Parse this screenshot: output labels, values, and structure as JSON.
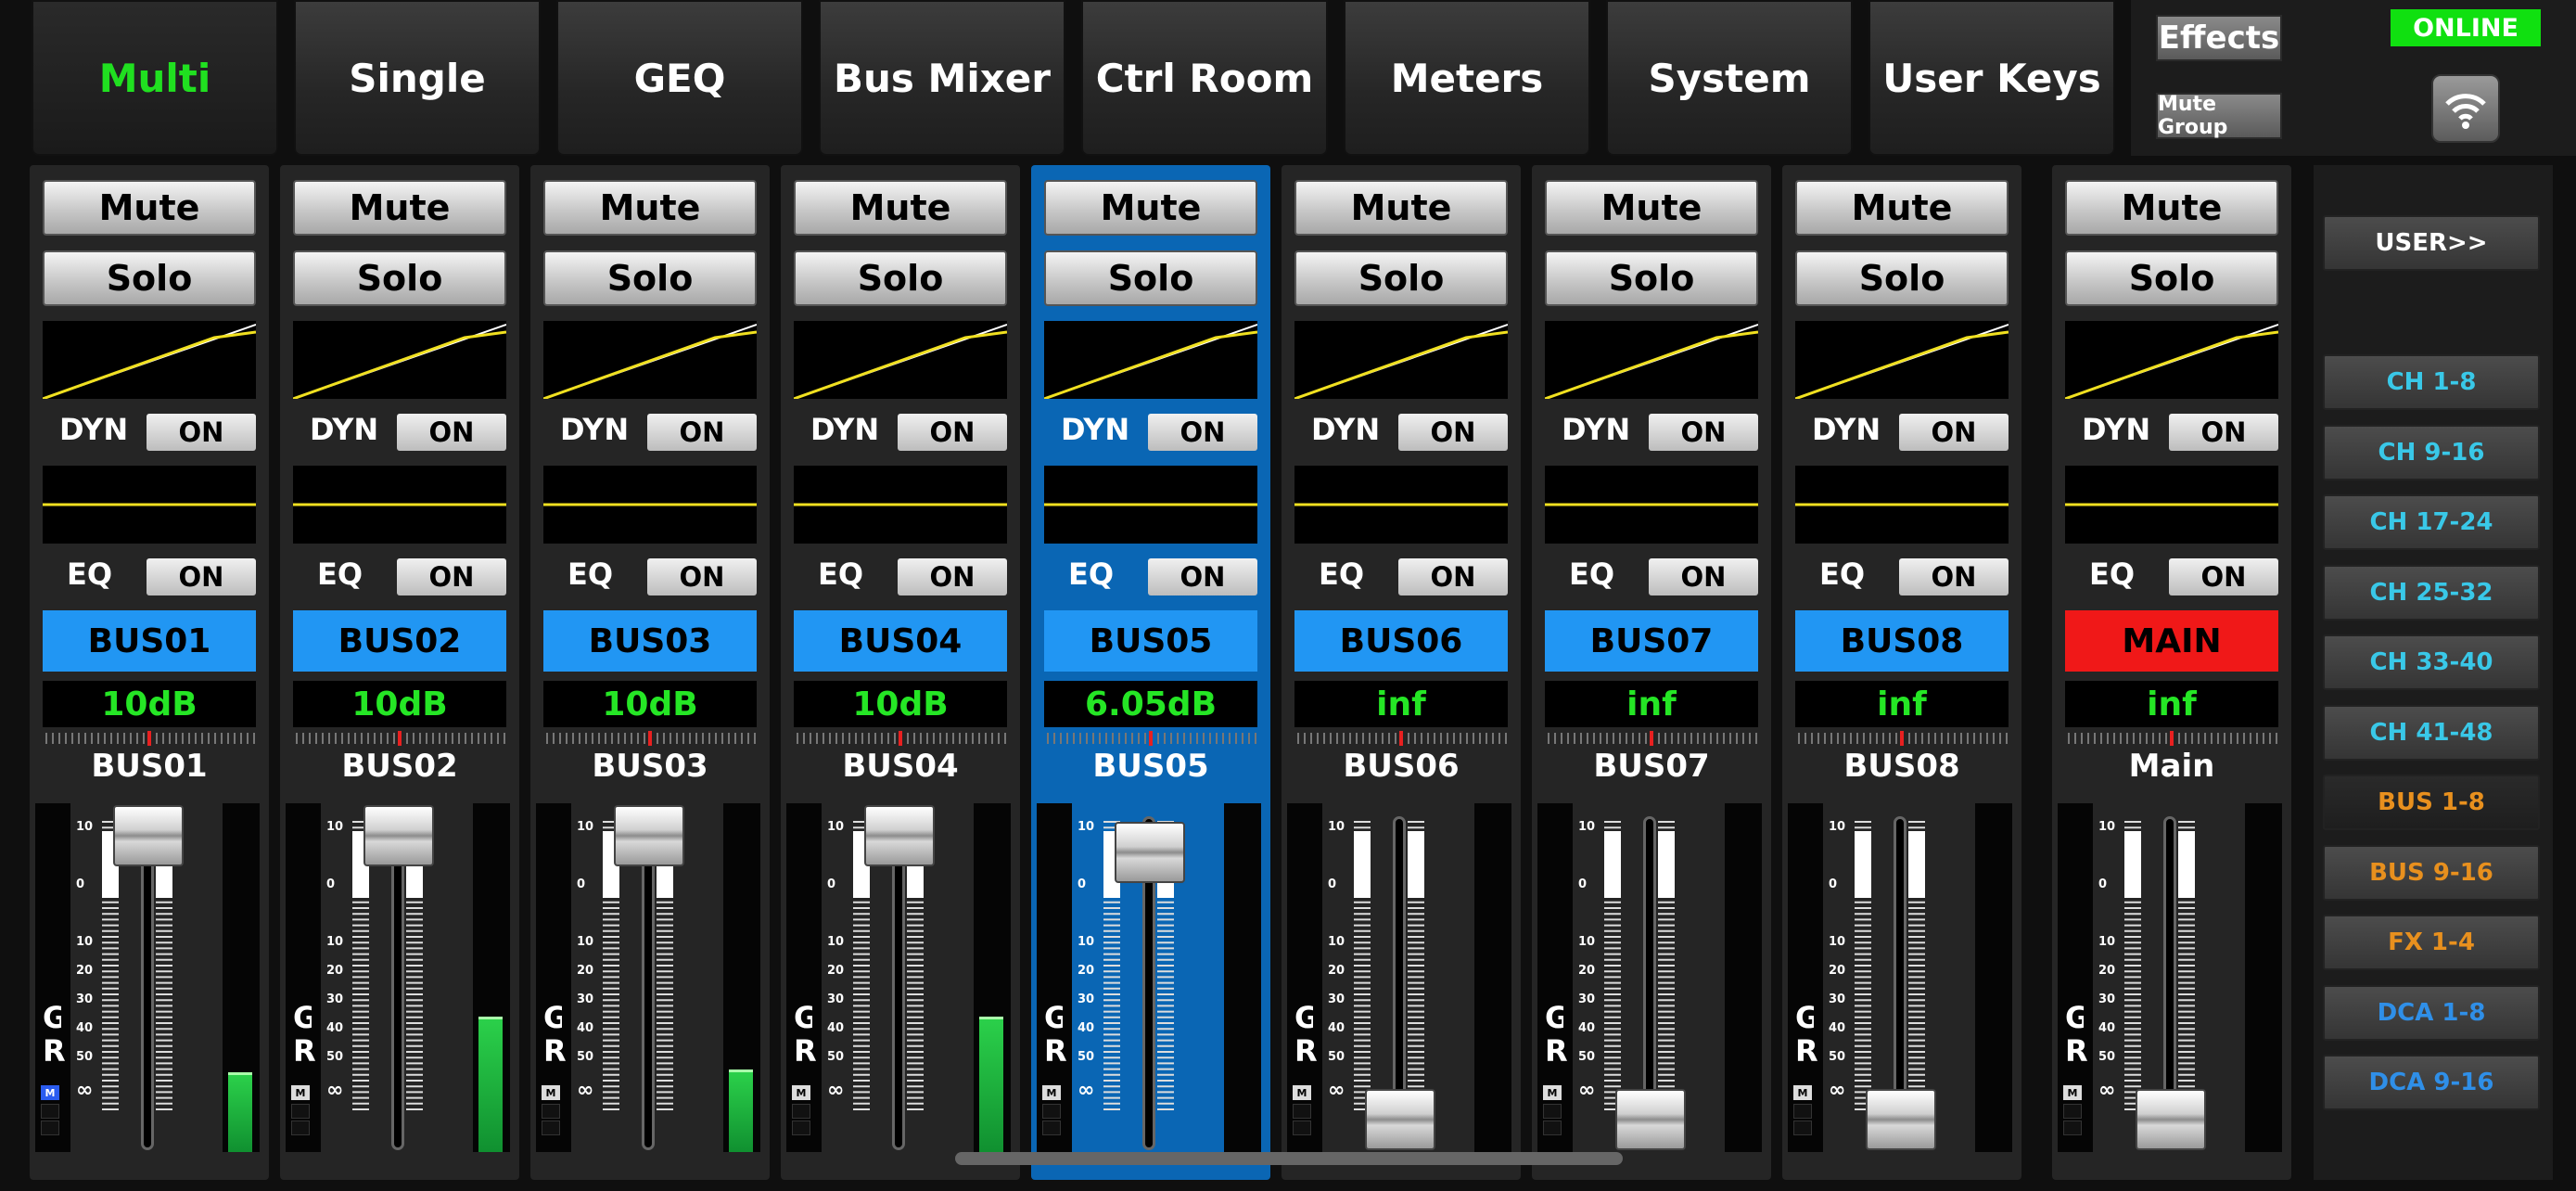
{
  "tabs": [
    "Multi",
    "Single",
    "GEQ",
    "Bus Mixer",
    "Ctrl Room",
    "Meters",
    "System",
    "User Keys"
  ],
  "active_tab": "Multi",
  "top_right": {
    "effects": "Effects",
    "mute_group": "Mute Group",
    "status": "ONLINE",
    "wifi_icon": "wifi-icon"
  },
  "labels": {
    "mute": "Mute",
    "solo": "Solo",
    "dyn": "DYN",
    "eq": "EQ",
    "on": "ON",
    "gr": "GR",
    "m": "M"
  },
  "fader_scale": [
    "10",
    "0",
    "10",
    "20",
    "30",
    "40",
    "50",
    "∞"
  ],
  "strips": [
    {
      "bus": "BUS01",
      "value": "10dB",
      "name": "BUS01",
      "level_right": 0.22,
      "fader": "10dB"
    },
    {
      "bus": "BUS02",
      "value": "10dB",
      "name": "BUS02",
      "level_right": 0.38,
      "fader": "10dB"
    },
    {
      "bus": "BUS03",
      "value": "10dB",
      "name": "BUS03",
      "level_right": 0.23,
      "fader": "10dB"
    },
    {
      "bus": "BUS04",
      "value": "10dB",
      "name": "BUS04",
      "level_right": 0.38,
      "fader": "10dB"
    },
    {
      "bus": "BUS05",
      "value": "6.05dB",
      "name": "BUS05",
      "level_right": 0,
      "fader": "6.05dB",
      "selected": true
    },
    {
      "bus": "BUS06",
      "value": "inf",
      "name": "BUS06",
      "level_right": 0,
      "fader": "inf"
    },
    {
      "bus": "BUS07",
      "value": "inf",
      "name": "BUS07",
      "level_right": 0,
      "fader": "inf"
    },
    {
      "bus": "BUS08",
      "value": "inf",
      "name": "BUS08",
      "level_right": 0,
      "fader": "inf"
    },
    {
      "bus": "MAIN",
      "value": "inf",
      "name": "Main",
      "level_right": 0,
      "fader": "inf",
      "main": true
    }
  ],
  "right_panel": {
    "user": "USER>>",
    "items": [
      {
        "label": "CH 1-8",
        "color": "#39c8e8"
      },
      {
        "label": "CH 9-16",
        "color": "#39c8e8"
      },
      {
        "label": "CH 17-24",
        "color": "#39c8e8"
      },
      {
        "label": "CH 25-32",
        "color": "#39c8e8"
      },
      {
        "label": "CH 33-40",
        "color": "#39c8e8"
      },
      {
        "label": "CH 41-48",
        "color": "#39c8e8"
      },
      {
        "label": "BUS 1-8",
        "color": "#e8901e",
        "active": true
      },
      {
        "label": "BUS 9-16",
        "color": "#e8901e"
      },
      {
        "label": "FX 1-4",
        "color": "#e8901e"
      },
      {
        "label": "DCA 1-8",
        "color": "#2f8fe8"
      },
      {
        "label": "DCA 9-16",
        "color": "#2f8fe8"
      }
    ]
  },
  "colors": {
    "accent_green": "#20e020",
    "bus_blue": "#2196f3",
    "main_red": "#f01818",
    "selected_strip": "#0a66b4",
    "curve": "#f0e020"
  }
}
